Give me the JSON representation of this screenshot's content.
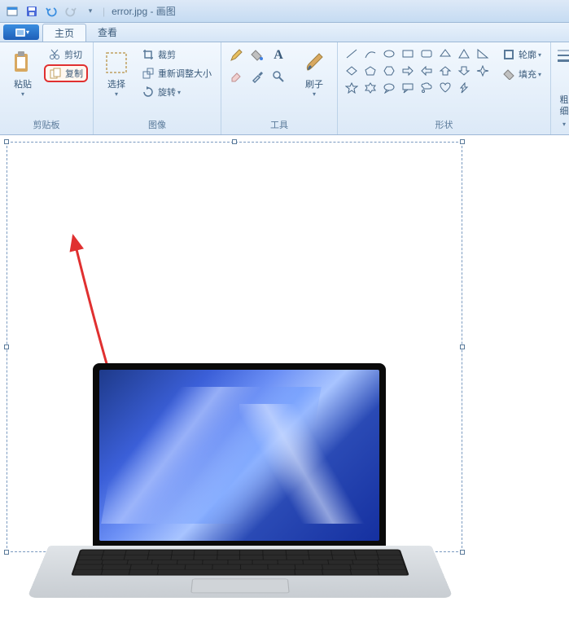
{
  "title": "error.jpg - 画图",
  "tabs": {
    "home": "主页",
    "view": "查看"
  },
  "ribbon": {
    "clipboard": {
      "label": "剪贴板",
      "paste": "粘贴",
      "cut": "剪切",
      "copy": "复制"
    },
    "image": {
      "label": "图像",
      "select": "选择",
      "crop": "裁剪",
      "resize": "重新调整大小",
      "rotate": "旋转"
    },
    "tools": {
      "label": "工具",
      "brush": "刷子"
    },
    "shapes": {
      "label": "形状",
      "outline": "轮廓",
      "fill": "填充"
    },
    "stroke": {
      "label": "粗细"
    }
  }
}
